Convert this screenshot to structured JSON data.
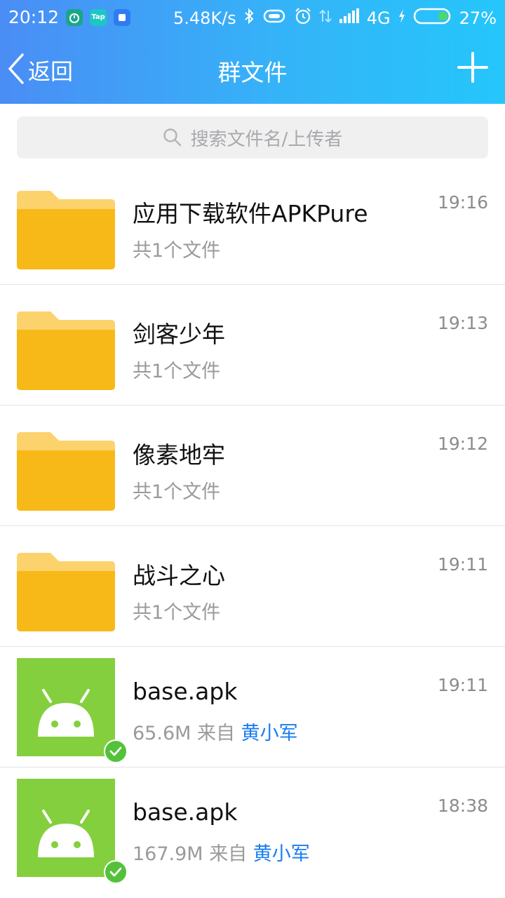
{
  "status_bar": {
    "time": "20:12",
    "app_tap_label": "Tap",
    "network_speed": "5.48K/s",
    "network_type": "4G",
    "battery": "27%"
  },
  "header": {
    "back_label": "返回",
    "title": "群文件",
    "add_icon": "plus-icon"
  },
  "search": {
    "placeholder": "搜索文件名/上传者"
  },
  "files": [
    {
      "type": "folder",
      "name": "应用下载软件APKPure",
      "sub": "共1个文件",
      "time": "19:16"
    },
    {
      "type": "folder",
      "name": "剑客少年",
      "sub": "共1个文件",
      "time": "19:13"
    },
    {
      "type": "folder",
      "name": "像素地牢",
      "sub": "共1个文件",
      "time": "19:12"
    },
    {
      "type": "folder",
      "name": "战斗之心",
      "sub": "共1个文件",
      "time": "19:11"
    },
    {
      "type": "apk",
      "name": "base.apk",
      "size": "65.6M",
      "from_label": "来自",
      "uploader": "黄小军",
      "time": "19:11"
    },
    {
      "type": "apk",
      "name": "base.apk",
      "size": "167.9M",
      "from_label": "来自",
      "uploader": "黄小军",
      "time": "18:38"
    }
  ],
  "colors": {
    "header_start": "#4a8df5",
    "header_end": "#25c6fb",
    "folder": "#f7b918",
    "apk_bg": "#84cf3e",
    "uploader_link": "#1a7cf5"
  }
}
